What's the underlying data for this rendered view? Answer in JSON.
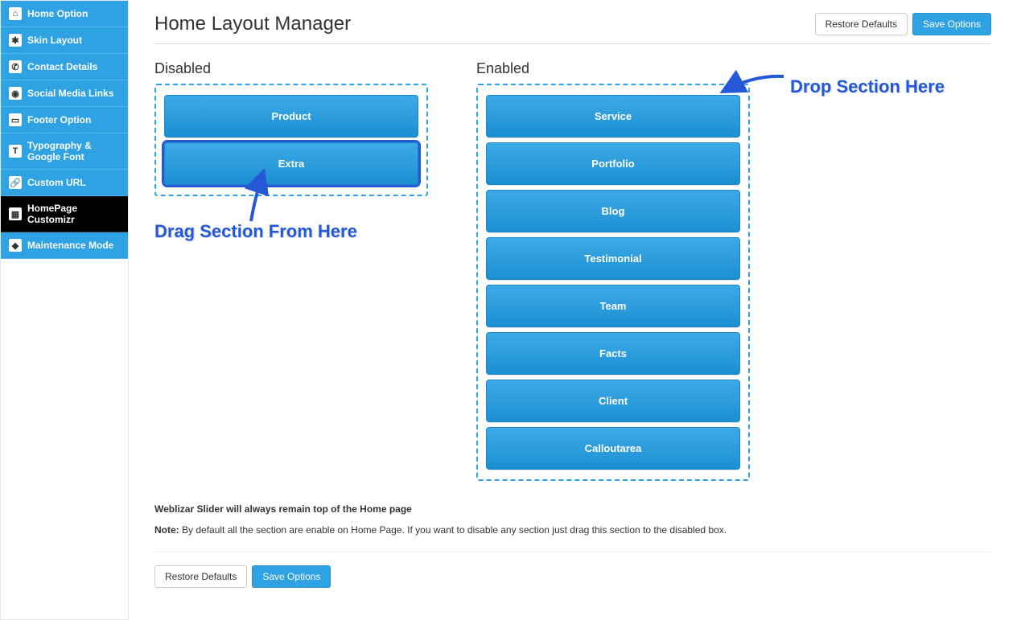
{
  "sidebar": {
    "items": [
      {
        "icon": "⌂",
        "label": "Home Option"
      },
      {
        "icon": "✱",
        "label": "Skin Layout"
      },
      {
        "icon": "✆",
        "label": "Contact Details"
      },
      {
        "icon": "◉",
        "label": "Social Media Links"
      },
      {
        "icon": "▭",
        "label": "Footer Option"
      },
      {
        "icon": "T",
        "label": "Typography & Google Font"
      },
      {
        "icon": "🔗",
        "label": "Custom URL"
      },
      {
        "icon": "▦",
        "label": "HomePage Customizr"
      },
      {
        "icon": "◆",
        "label": "Maintenance Mode"
      }
    ],
    "activeIndex": 7
  },
  "page": {
    "title": "Home Layout Manager",
    "restore": "Restore Defaults",
    "save": "Save Options"
  },
  "columns": {
    "disabled_heading": "Disabled",
    "enabled_heading": "Enabled"
  },
  "disabled": [
    {
      "label": "Product"
    },
    {
      "label": "Extra"
    }
  ],
  "enabled": [
    {
      "label": "Service"
    },
    {
      "label": "Portfolio"
    },
    {
      "label": "Blog"
    },
    {
      "label": "Testimonial"
    },
    {
      "label": "Team"
    },
    {
      "label": "Facts"
    },
    {
      "label": "Client"
    },
    {
      "label": "Calloutarea"
    }
  ],
  "annotations": {
    "drag": "Drag Section From Here",
    "drop": "Drop Section Here"
  },
  "notes": {
    "slider": "Weblizar Slider will always remain top of the Home page",
    "note_label": "Note:",
    "note_body": " By default all the section are enable on Home Page. If you want to disable any section just drag this section to the disabled box."
  }
}
